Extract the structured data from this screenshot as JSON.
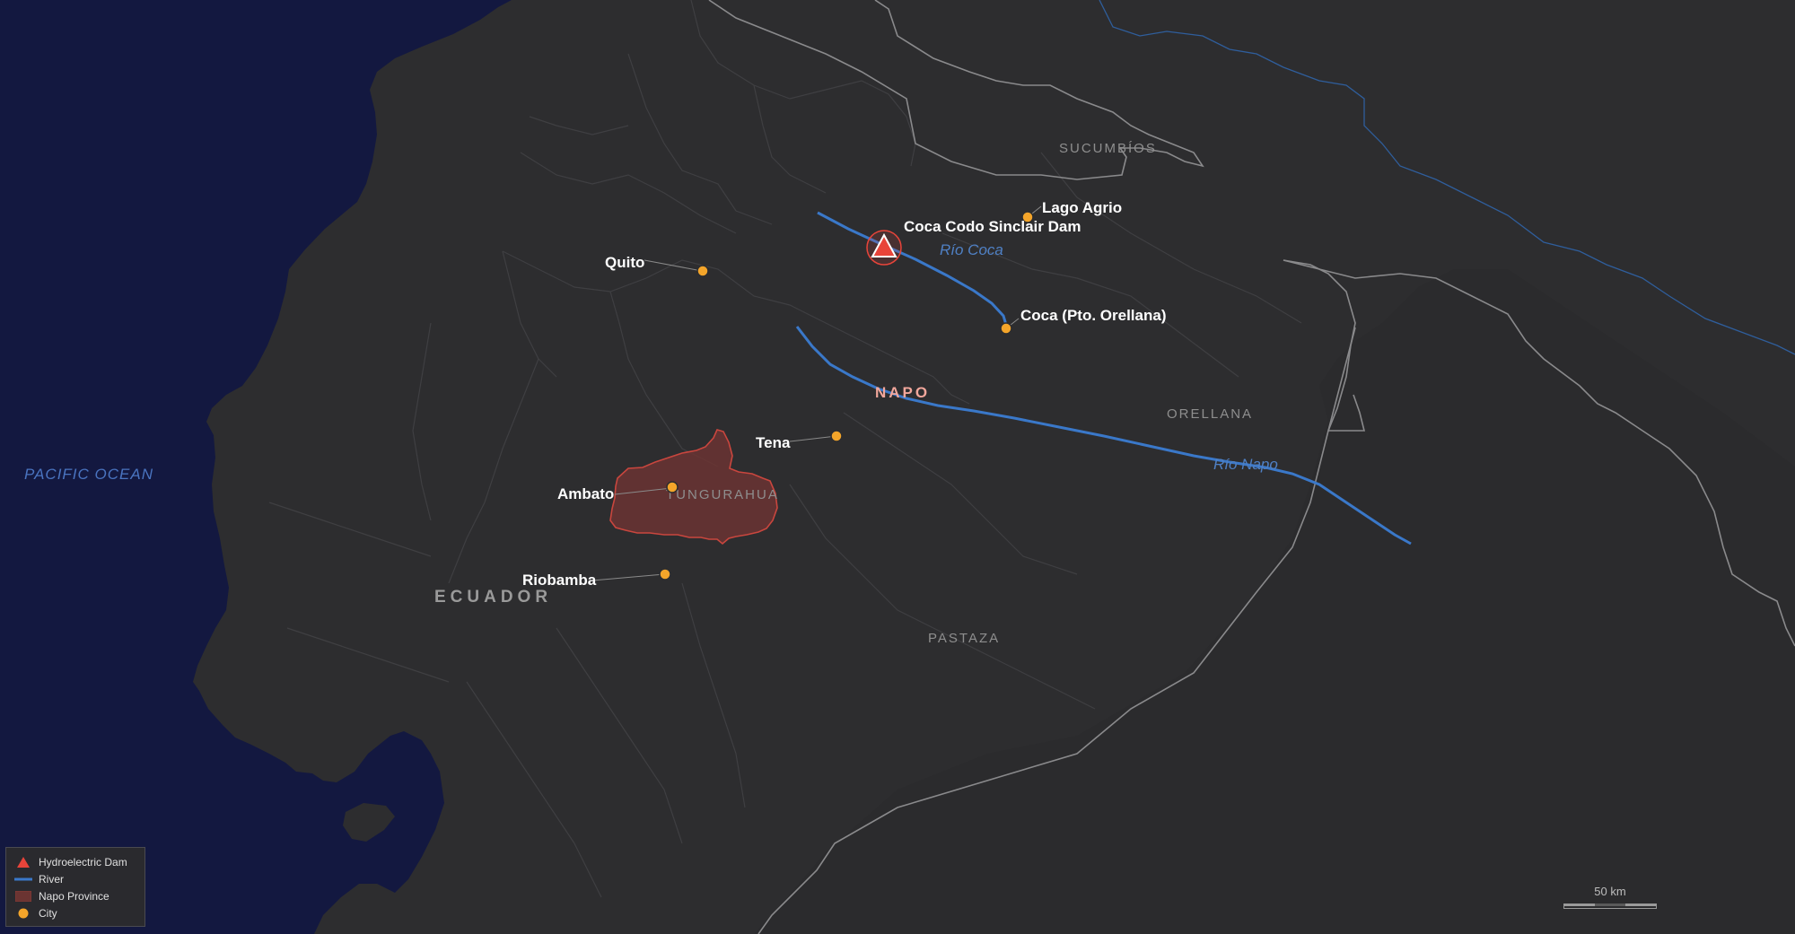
{
  "map": {
    "ocean_label": "PACIFIC OCEAN",
    "country_label": "ECUADOR",
    "province_labels": {
      "sucumbios": "SUCUMBÍOS",
      "orellana": "ORELLANA",
      "pastaza": "PASTAZA",
      "tungurahua": "TUNGURAHUA"
    },
    "napo_label": "NAPO",
    "rivers": {
      "coca": "Río Coca",
      "napo": "Río Napo"
    },
    "dam": {
      "name": "Coca Codo Sinclair Dam"
    },
    "cities": {
      "quito": "Quito",
      "lago_agrio": "Lago Agrio",
      "coca": "Coca (Pto. Orellana)",
      "tena": "Tena",
      "ambato": "Ambato",
      "riobamba": "Riobamba"
    },
    "colors": {
      "ocean": "#131840",
      "land": "#2d2d2f",
      "boundary": "#3f3f42",
      "river": "#3a78c9",
      "dam": "#e8443a",
      "city": "#f4a52a",
      "highlight_fill": "#6b3432",
      "highlight_stroke": "#c9463e"
    }
  },
  "legend": {
    "items": [
      {
        "label": "Hydroelectric Dam",
        "icon": "triangle"
      },
      {
        "label": "River",
        "icon": "line"
      },
      {
        "label": "Napo Province",
        "icon": "square"
      },
      {
        "label": "City",
        "icon": "circle"
      }
    ]
  },
  "scale": {
    "label": "50 km"
  }
}
